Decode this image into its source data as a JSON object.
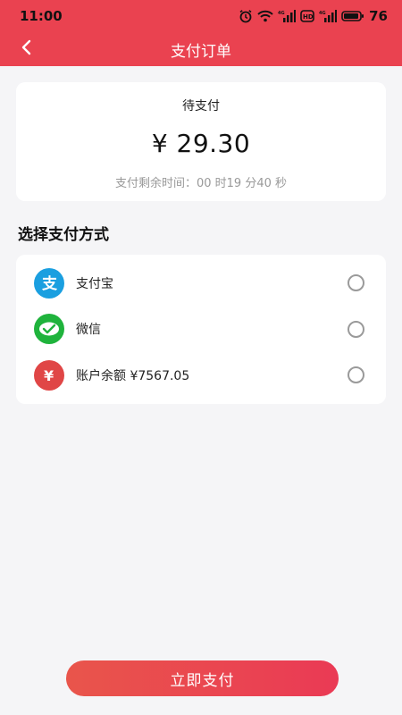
{
  "status_bar": {
    "time": "11:00",
    "battery": "76",
    "icons": [
      "alarm-icon",
      "wifi-icon",
      "signal-icon",
      "hd-icon",
      "signal-icon",
      "battery-icon"
    ]
  },
  "nav": {
    "title": "支付订单",
    "back_icon": "chevron-left-icon"
  },
  "order": {
    "status": "待支付",
    "amount": "¥ 29.30",
    "countdown": "支付剩余时间：00 时19 分40 秒"
  },
  "payment": {
    "section_title": "选择支付方式",
    "methods": [
      {
        "label": "支付宝",
        "icon": "alipay-icon",
        "color": "#1a9fe0"
      },
      {
        "label": "微信",
        "icon": "wechat-icon",
        "color": "#1fb33c"
      },
      {
        "label": "账户余额 ¥7567.05",
        "icon": "balance-icon",
        "color": "#e04646"
      }
    ]
  },
  "actions": {
    "pay_label": "立即支付"
  },
  "colors": {
    "brand": "#ea4250",
    "background": "#f5f5f7"
  }
}
